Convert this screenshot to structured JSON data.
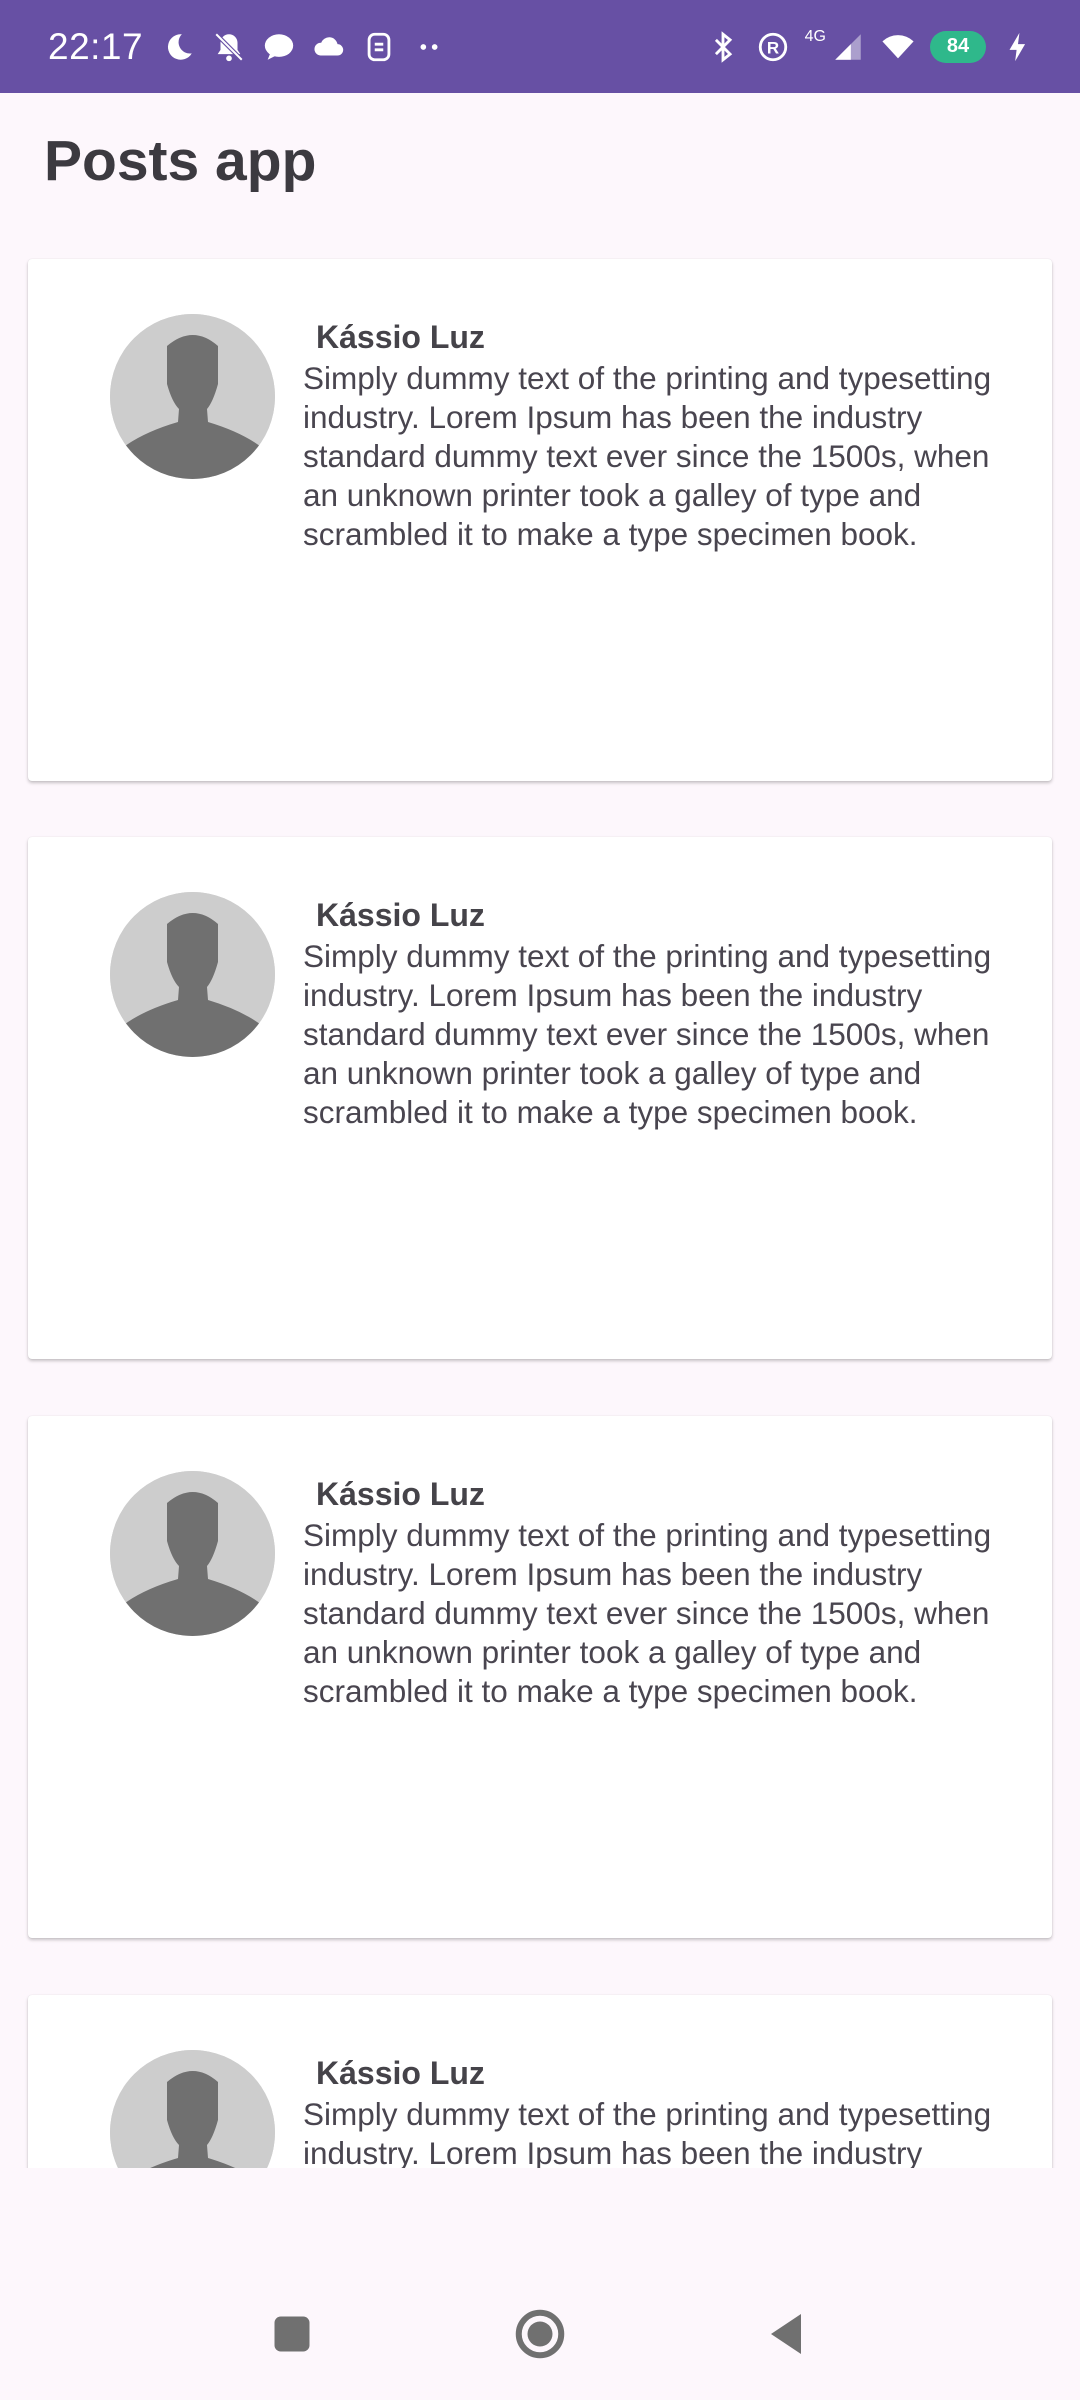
{
  "status_bar": {
    "time": "22:17",
    "left_icons": [
      "moon-icon",
      "bell-off-icon",
      "chat-bubble-icon",
      "cloud-icon",
      "sim-app-icon",
      "more-dots-icon"
    ],
    "right_icons": [
      "bluetooth-icon",
      "registered-icon",
      "signal-icon",
      "wifi-icon",
      "charging-icon"
    ],
    "network_label": "4G",
    "battery": "84",
    "color": "#6750a4",
    "battery_color": "#2fb88b"
  },
  "header": {
    "title": "Posts app"
  },
  "posts": [
    {
      "author": "Kássio Luz",
      "body": "Simply dummy text of the printing and typesetting industry. Lorem Ipsum has been the industry standard dummy text ever since the 1500s, when an unknown printer took a galley of type and scrambled it to make a type specimen book.",
      "avatar": "person-placeholder-icon"
    },
    {
      "author": "Kássio Luz",
      "body": "Simply dummy text of the printing and typesetting industry. Lorem Ipsum has been the industry standard dummy text ever since the 1500s, when an unknown printer took a galley of type and scrambled it to make a type specimen book.",
      "avatar": "person-placeholder-icon"
    },
    {
      "author": "Kássio Luz",
      "body": "Simply dummy text of the printing and typesetting industry. Lorem Ipsum has been the industry standard dummy text ever since the 1500s, when an unknown printer took a galley of type and scrambled it to make a type specimen book.",
      "avatar": "person-placeholder-icon"
    },
    {
      "author": "Kássio Luz",
      "body": "Simply dummy text of the printing and typesetting industry. Lorem Ipsum has been the industry standard dummy text ever since the 1500s, when an unknown printer took a galley of type and scrambled it to make a type specimen book.",
      "avatar": "person-placeholder-icon"
    }
  ],
  "nav_bar": {
    "buttons": [
      "recents-square-icon",
      "home-circle-icon",
      "back-triangle-icon"
    ]
  }
}
